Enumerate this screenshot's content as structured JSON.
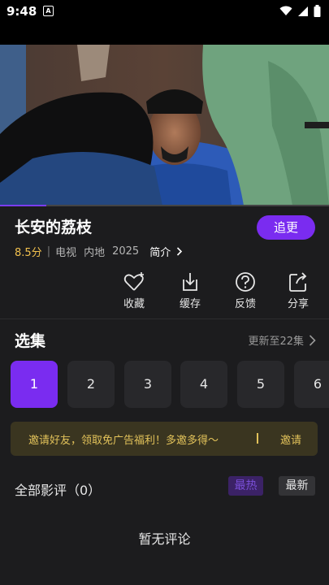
{
  "status_bar": {
    "time": "9:48",
    "notification_icon": "A"
  },
  "player": {
    "progress": 0.14
  },
  "show": {
    "title": "长安的荔枝",
    "follow_label": "追更",
    "score": "8.5分",
    "separator": "|",
    "genre": "电视",
    "region": "内地",
    "year": "2025",
    "intro_label": "简介"
  },
  "actions": [
    {
      "icon": "heart-plus-icon",
      "label": "收藏"
    },
    {
      "icon": "download-icon",
      "label": "缓存"
    },
    {
      "icon": "question-icon",
      "label": "反馈"
    },
    {
      "icon": "share-icon",
      "label": "分享"
    }
  ],
  "episodes": {
    "title": "选集",
    "update_info": "更新至22集",
    "items": [
      "1",
      "2",
      "3",
      "4",
      "5",
      "6"
    ],
    "active_index": 0
  },
  "banner": {
    "text": "邀请好友，领取免广告福利！多邀多得～",
    "button": "邀请"
  },
  "reviews": {
    "title": "全部影评（0）",
    "sort_hot": "最热",
    "sort_new": "最新",
    "empty_text": "暂无评论"
  },
  "colors": {
    "accent": "#7a2cf0",
    "score": "#f2c14e",
    "banner_text": "#e2c25a"
  }
}
